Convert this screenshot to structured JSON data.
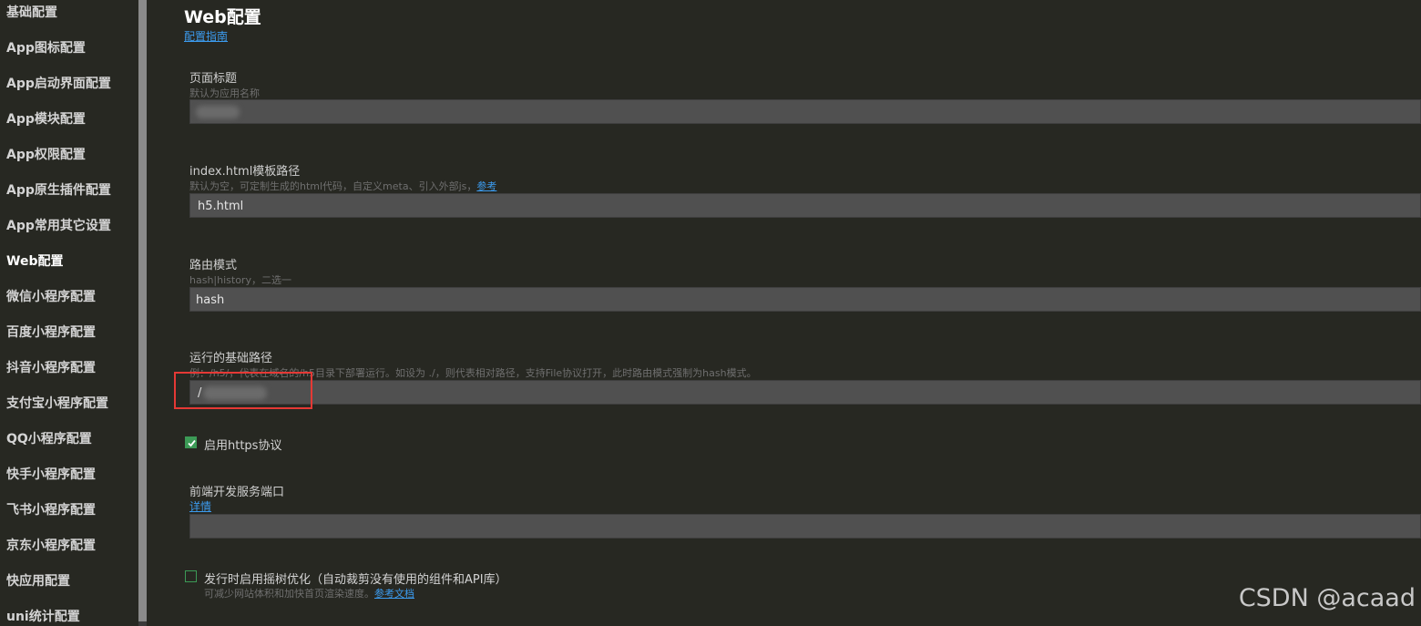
{
  "sidebar": {
    "items": [
      {
        "label": "基础配置"
      },
      {
        "label": "App图标配置"
      },
      {
        "label": "App启动界面配置"
      },
      {
        "label": "App模块配置"
      },
      {
        "label": "App权限配置"
      },
      {
        "label": "App原生插件配置"
      },
      {
        "label": "App常用其它设置"
      },
      {
        "label": "Web配置"
      },
      {
        "label": "微信小程序配置"
      },
      {
        "label": "百度小程序配置"
      },
      {
        "label": "抖音小程序配置"
      },
      {
        "label": "支付宝小程序配置"
      },
      {
        "label": "QQ小程序配置"
      },
      {
        "label": "快手小程序配置"
      },
      {
        "label": "飞书小程序配置"
      },
      {
        "label": "京东小程序配置"
      },
      {
        "label": "快应用配置"
      },
      {
        "label": "uni统计配置"
      }
    ],
    "active": "Web配置"
  },
  "main": {
    "title": "Web配置",
    "guide_link": "配置指南",
    "fields": {
      "page_title": {
        "label": "页面标题",
        "desc": "默认为应用名称",
        "value": ""
      },
      "template": {
        "label": "index.html模板路径",
        "desc": "默认为空，可定制生成的html代码，自定义meta、引入外部js，",
        "desc_link": "参考",
        "value": "h5.html"
      },
      "router_mode": {
        "label": "路由模式",
        "desc": "hash|history，二选一",
        "value": "hash"
      },
      "base_path": {
        "label": "运行的基础路径",
        "desc": "例：/h5/，代表在域名的/h5目录下部署运行。如设为 ./，则代表相对路径，支持File协议打开，此时路由模式强制为hash模式。",
        "value": "/"
      },
      "https": {
        "label": "启用https协议",
        "checked": true
      },
      "dev_port": {
        "label": "前端开发服务端口",
        "link": "详情",
        "value": ""
      },
      "tree_shaking": {
        "label": "发行时启用摇树优化（自动裁剪没有使用的组件和API库）",
        "desc": "可减少网站体积和加快首页渲染速度。",
        "desc_link": "参考文档",
        "checked": false
      }
    }
  },
  "watermark": "CSDN @acaad",
  "colors": {
    "background": "#272822",
    "input": "#505050",
    "link": "#3c9cf0",
    "checkbox": "#3c9a56",
    "highlight": "#e53935"
  }
}
